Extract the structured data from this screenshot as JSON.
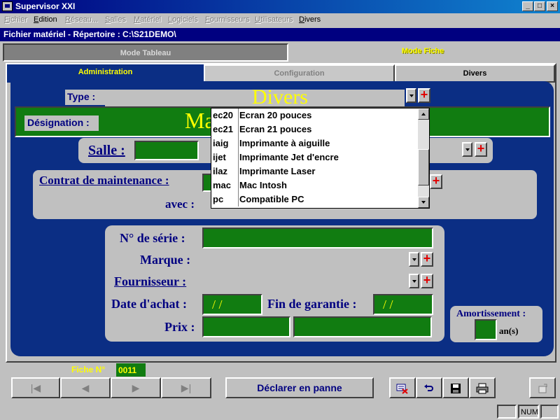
{
  "window": {
    "title": "Supervisor XXI",
    "minimize": "_",
    "maximize": "□",
    "close": "×"
  },
  "menu": [
    {
      "label": "Fichier",
      "enabled": false
    },
    {
      "label": "Edition",
      "enabled": true
    },
    {
      "label": "Réseau...",
      "enabled": false
    },
    {
      "label": "Salles",
      "enabled": false
    },
    {
      "label": "Matériel",
      "enabled": false
    },
    {
      "label": "Logiciels",
      "enabled": false
    },
    {
      "label": "Fournisseurs",
      "enabled": false
    },
    {
      "label": "Utilisateurs",
      "enabled": false
    },
    {
      "label": "Divers",
      "enabled": true
    }
  ],
  "path": "Fichier matériel - Répertoire : C:\\S21DEMO\\",
  "mode_tabs": {
    "tableau": "Mode Tableau",
    "fiche": "Mode Fiche"
  },
  "sub_tabs": {
    "admin": "Administration",
    "config": "Configuration",
    "divers": "Divers"
  },
  "form": {
    "type_label": "Type :",
    "type_value": "Divers",
    "designation_label": "Désignation :",
    "designation_value": "Ma",
    "salle_label": "Salle :",
    "contrat_label": "Contrat de maintenance :",
    "avec_label": "avec :",
    "serie_label": "N° de série :",
    "marque_label": "Marque :",
    "fournisseur_label": "Fournisseur :",
    "date_achat_label": "Date d'achat :",
    "date_achat_value": "/ /",
    "fin_garantie_label": "Fin de garantie :",
    "fin_garantie_value": "/ /",
    "prix_label": "Prix :",
    "amort_label": "Amortissement :",
    "amort_unit": "an(s)"
  },
  "dropdown": {
    "items": [
      {
        "code": "ec20",
        "label": "Ecran 20 pouces"
      },
      {
        "code": "ec21",
        "label": "Ecran 21 pouces"
      },
      {
        "code": "iaig",
        "label": "Imprimante à aiguille"
      },
      {
        "code": "ijet",
        "label": "Imprimante Jet d'encre"
      },
      {
        "code": "ilaz",
        "label": "Imprimante Laser"
      },
      {
        "code": "mac",
        "label": "Mac Intosh"
      },
      {
        "code": "pc",
        "label": "Compatible PC"
      }
    ],
    "scroll_fraction": 0.72
  },
  "footer": {
    "fiche_label": "Fiche N°",
    "fiche_value": "0011",
    "panne_button": "Déclarer en panne",
    "nav": {
      "first": "|◀",
      "prev": "◀",
      "next": "▶",
      "last": "▶|"
    },
    "status_num": "NUM"
  },
  "colors": {
    "form_bg": "#0b2e84",
    "field_green": "#117c11",
    "accent_yellow": "#ffff00",
    "label_navy": "#000080",
    "plus_red": "#e00000"
  }
}
